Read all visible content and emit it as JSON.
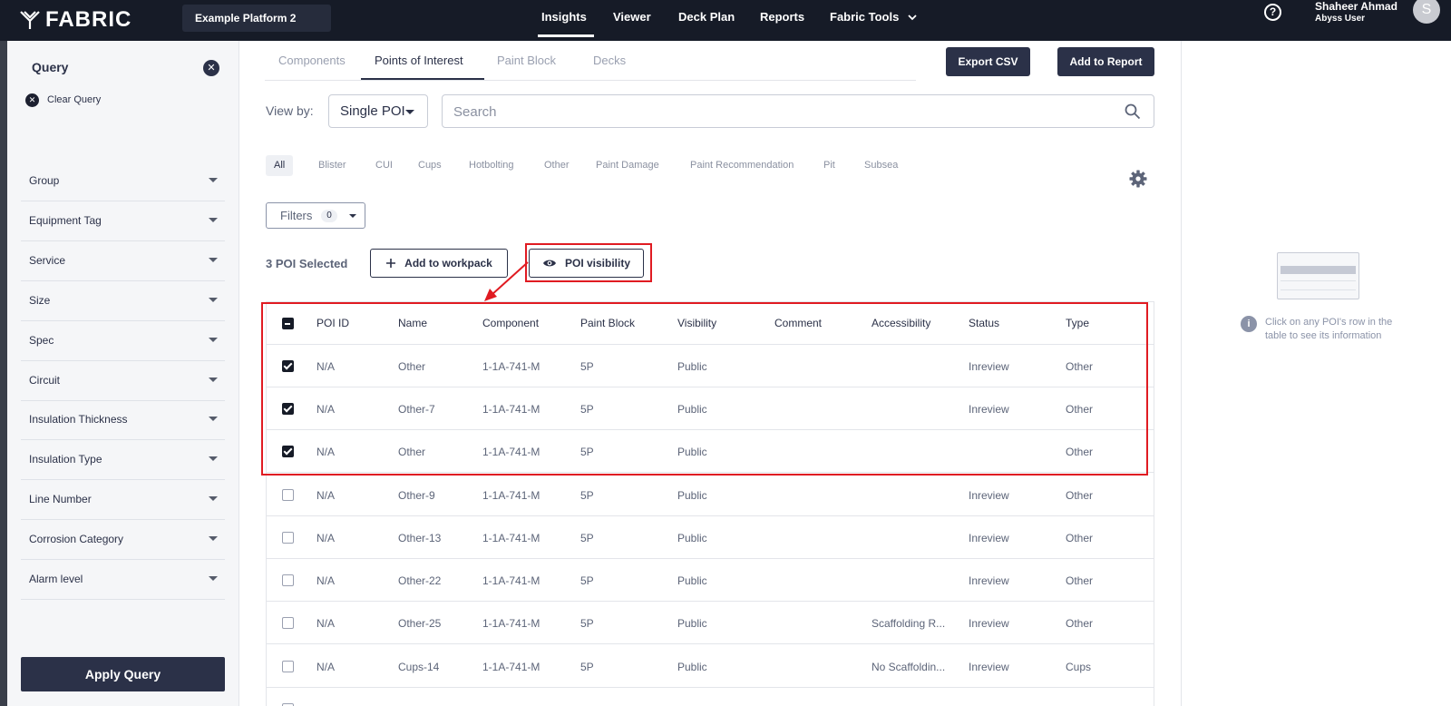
{
  "topbar": {
    "brand": "FABRIC",
    "platform": "Example Platform 2",
    "nav": [
      "Insights",
      "Viewer",
      "Deck Plan",
      "Reports",
      "Fabric Tools"
    ],
    "active_nav": "Insights",
    "help_icon": "help-circle-icon",
    "user_name": "Shaheer Ahmad",
    "user_role": "Abyss User",
    "avatar_initial": "S"
  },
  "sidebar": {
    "title": "Query",
    "clear_label": "Clear Query",
    "filters": [
      "Group",
      "Equipment Tag",
      "Service",
      "Size",
      "Spec",
      "Circuit",
      "Insulation Thickness",
      "Insulation Type",
      "Line Number",
      "Corrosion Category",
      "Alarm level"
    ],
    "apply_label": "Apply Query"
  },
  "tabs": [
    "Components",
    "Points of Interest",
    "Paint Block",
    "Decks"
  ],
  "active_tab": "Points of Interest",
  "actions": {
    "export_label": "Export CSV",
    "report_label": "Add to Report"
  },
  "viewby": {
    "label": "View by:",
    "value": "Single POI"
  },
  "search": {
    "placeholder": "Search"
  },
  "chips": [
    "All",
    "Blister",
    "CUI",
    "Cups",
    "Hotbolting",
    "Other",
    "Paint Damage",
    "Paint Recommendation",
    "Pit",
    "Subsea"
  ],
  "active_chip": "All",
  "filters_btn": {
    "label": "Filters",
    "count": "0"
  },
  "selection": {
    "count_label": "3 POI Selected",
    "workpack_label": "Add to workpack",
    "visibility_label": "POI visibility"
  },
  "table": {
    "columns": [
      "POI ID",
      "Name",
      "Component",
      "Paint Block",
      "Visibility",
      "Comment",
      "Accessibility",
      "Status",
      "Type"
    ],
    "rows": [
      {
        "checked": true,
        "cells": [
          "N/A",
          "Other",
          "1-1A-741-M",
          "5P",
          "Public",
          "",
          "",
          "Inreview",
          "Other"
        ]
      },
      {
        "checked": true,
        "cells": [
          "N/A",
          "Other-7",
          "1-1A-741-M",
          "5P",
          "Public",
          "",
          "",
          "Inreview",
          "Other"
        ]
      },
      {
        "checked": true,
        "cells": [
          "N/A",
          "Other",
          "1-1A-741-M",
          "5P",
          "Public",
          "",
          "",
          "",
          "Other"
        ]
      },
      {
        "checked": false,
        "cells": [
          "N/A",
          "Other-9",
          "1-1A-741-M",
          "5P",
          "Public",
          "",
          "",
          "Inreview",
          "Other"
        ]
      },
      {
        "checked": false,
        "cells": [
          "N/A",
          "Other-13",
          "1-1A-741-M",
          "5P",
          "Public",
          "",
          "",
          "Inreview",
          "Other"
        ]
      },
      {
        "checked": false,
        "cells": [
          "N/A",
          "Other-22",
          "1-1A-741-M",
          "5P",
          "Public",
          "",
          "",
          "Inreview",
          "Other"
        ]
      },
      {
        "checked": false,
        "cells": [
          "N/A",
          "Other-25",
          "1-1A-741-M",
          "5P",
          "Public",
          "",
          "Scaffolding R...",
          "Inreview",
          "Other"
        ]
      },
      {
        "checked": false,
        "cells": [
          "N/A",
          "Cups-14",
          "1-1A-741-M",
          "5P",
          "Public",
          "",
          "No Scaffoldin...",
          "Inreview",
          "Cups"
        ]
      },
      {
        "checked": false,
        "cells": [
          "",
          "",
          "",
          "",
          "",
          "",
          "",
          "",
          ""
        ]
      }
    ]
  },
  "info_panel": {
    "text": "Click on any POI's row in the table to see its information"
  },
  "colors": {
    "navy": "#2b3148",
    "topbar": "#161b27",
    "highlight": "#e01b22"
  }
}
